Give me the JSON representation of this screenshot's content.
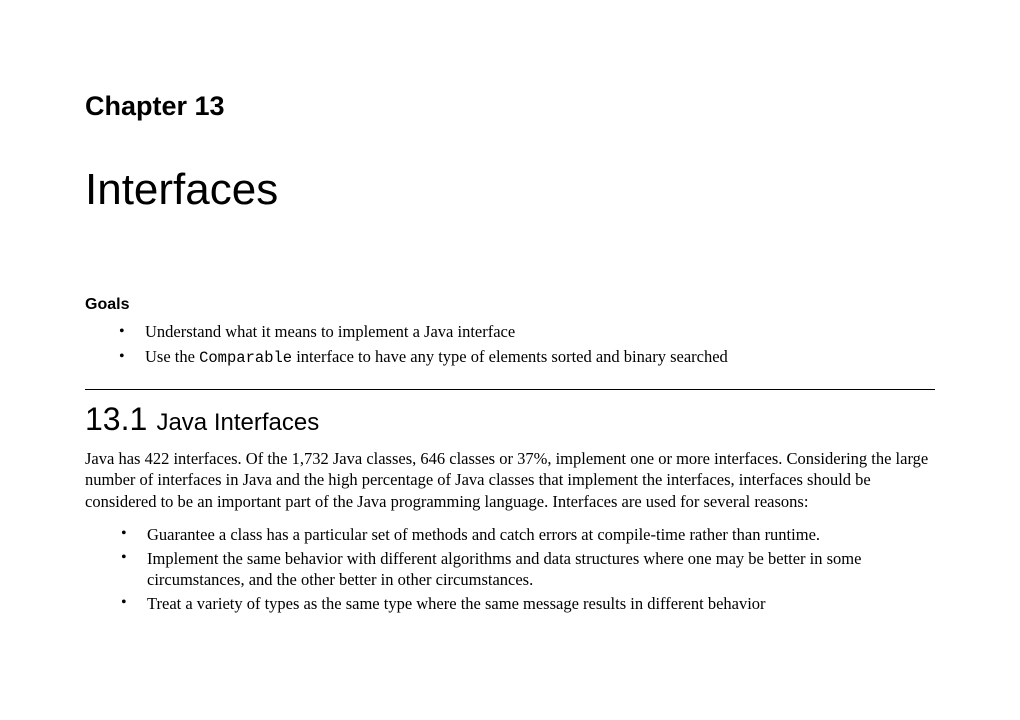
{
  "chapter": {
    "number": "Chapter 13",
    "title": "Interfaces"
  },
  "goals": {
    "heading": "Goals",
    "items": [
      {
        "text": "Understand what it means to implement a Java interface"
      },
      {
        "prefix": "Use the ",
        "code": "Comparable",
        "suffix": " interface to have any type of elements sorted and binary searched"
      }
    ]
  },
  "section": {
    "number": "13.1",
    "title": "Java Interfaces",
    "paragraph": "Java has 422 interfaces. Of the 1,732 Java classes, 646 classes or 37%, implement one or more interfaces. Considering the large number of interfaces in Java and the high percentage of Java classes that implement the interfaces, interfaces should be considered to be an important part of the Java programming language. Interfaces are used for several reasons:",
    "reasons": [
      "Guarantee a class has a particular set of methods and catch errors at compile-time rather than runtime.",
      "Implement the same behavior with different algorithms and data structures where one may be better in some circumstances, and the other better in other circumstances.",
      "Treat a variety of types as the same type where the same message results in different behavior"
    ]
  }
}
